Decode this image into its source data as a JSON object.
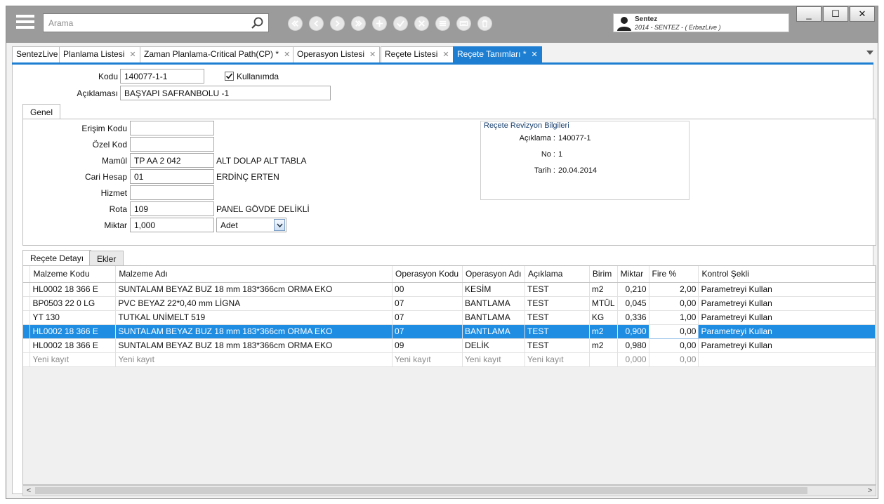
{
  "toolbar": {
    "search_placeholder": "Arama",
    "buttons": [
      "first-icon",
      "prev-icon",
      "next-icon",
      "last-icon",
      "add-icon",
      "check-icon",
      "cancel-icon",
      "list-icon",
      "keyboard-icon",
      "trash-icon"
    ]
  },
  "user": {
    "name": "Sentez",
    "subtitle": "2014 - SENTEZ - ( ErbazLive )"
  },
  "window": {
    "minimize": "_",
    "maximize": "☐",
    "close": "✕"
  },
  "tabs": [
    {
      "label": "SentezLive",
      "closable": false
    },
    {
      "label": "Planlama Listesi",
      "closable": true
    },
    {
      "label": "Zaman Planlama-Critical Path(CP) *",
      "closable": true
    },
    {
      "label": "Operasyon Listesi",
      "closable": true
    },
    {
      "label": "Reçete Listesi",
      "closable": true
    },
    {
      "label": "Reçete Tanımları *",
      "closable": true,
      "active": true
    }
  ],
  "header": {
    "kodu_label": "Kodu",
    "kodu_value": "140077-1-1",
    "kullanimda_label": "Kullanımda",
    "kullanimda_checked": true,
    "aciklama_label": "Açıklaması",
    "aciklama_value": "BAŞYAPI SAFRANBOLU -1"
  },
  "genel": {
    "tab_label": "Genel",
    "erisim_label": "Erişim Kodu",
    "erisim_value": "",
    "ozel_label": "Özel Kod",
    "ozel_value": "",
    "mamul_label": "Mamûl",
    "mamul_value": "TP AA 2 042",
    "mamul_desc": "ALT DOLAP  ALT TABLA",
    "cari_label": "Cari Hesap",
    "cari_value": "01",
    "cari_desc": "ERDİNÇ ERTEN",
    "hizmet_label": "Hizmet",
    "hizmet_value": "",
    "rota_label": "Rota",
    "rota_value": "109",
    "rota_desc": "PANEL GÖVDE DELİKLİ",
    "miktar_label": "Miktar",
    "miktar_value": "1,000",
    "birim_value": "Adet"
  },
  "revizyon": {
    "title": "Reçete Revizyon Bilgileri",
    "aciklama_label": "Açıklama :",
    "aciklama_value": "140077-1",
    "no_label": "No :",
    "no_value": "1",
    "tarih_label": "Tarih :",
    "tarih_value": "20.04.2014"
  },
  "detail_tabs": {
    "recete_detayi": "Reçete Detayı",
    "ekler": "Ekler"
  },
  "grid": {
    "columns": [
      "Malzeme Kodu",
      "Malzeme Adı",
      "Operasyon Kodu",
      "Operasyon Adı",
      "Açıklama",
      "Birim",
      "Miktar",
      "Fire %",
      "Kontrol Şekli"
    ],
    "rows": [
      {
        "kod": "HL0002 18 366 E",
        "ad": "SUNTALAM BEYAZ BUZ 18 mm 183*366cm ORMA EKO",
        "opkod": "00",
        "opad": "KESİM",
        "aciklama": "TEST",
        "birim": "m2",
        "miktar": "0,210",
        "fire": "2,00",
        "kontrol": "Parametreyi Kullan"
      },
      {
        "kod": "BP0503 22 0 LG",
        "ad": "PVC BEYAZ 22*0,40 mm LİGNA",
        "opkod": "07",
        "opad": "BANTLAMA",
        "aciklama": "TEST",
        "birim": "MTÜL",
        "miktar": "0,045",
        "fire": "0,00",
        "kontrol": "Parametreyi Kullan"
      },
      {
        "kod": "YT 130",
        "ad": "TUTKAL UNİMELT 519",
        "opkod": "07",
        "opad": "BANTLAMA",
        "aciklama": "TEST",
        "birim": "KG",
        "miktar": "0,336",
        "fire": "1,00",
        "kontrol": "Parametreyi Kullan"
      },
      {
        "kod": "HL0002 18 366 E",
        "ad": "SUNTALAM BEYAZ BUZ 18 mm 183*366cm ORMA EKO",
        "opkod": "07",
        "opad": "BANTLAMA",
        "aciklama": "TEST",
        "birim": "m2",
        "miktar": "0,900",
        "fire": "0,00",
        "kontrol": "Parametreyi Kullan",
        "selected": true
      },
      {
        "kod": "HL0002 18 366 E",
        "ad": "SUNTALAM BEYAZ BUZ 18 mm 183*366cm ORMA EKO",
        "opkod": "09",
        "opad": "DELİK",
        "aciklama": "TEST",
        "birim": "m2",
        "miktar": "0,980",
        "fire": "0,00",
        "kontrol": "Parametreyi Kullan"
      }
    ],
    "new_row": {
      "kod": "Yeni kayıt",
      "ad": "Yeni kayıt",
      "opkod": "Yeni kayıt",
      "opad": "Yeni kayıt",
      "aciklama": "Yeni kayıt",
      "birim": "",
      "miktar": "0,000",
      "fire": "0,00",
      "kontrol": ""
    }
  },
  "colors": {
    "accent": "#1e7fd2",
    "toolbar_bg": "#9b9b9b",
    "selected_row": "#1f8de2"
  }
}
